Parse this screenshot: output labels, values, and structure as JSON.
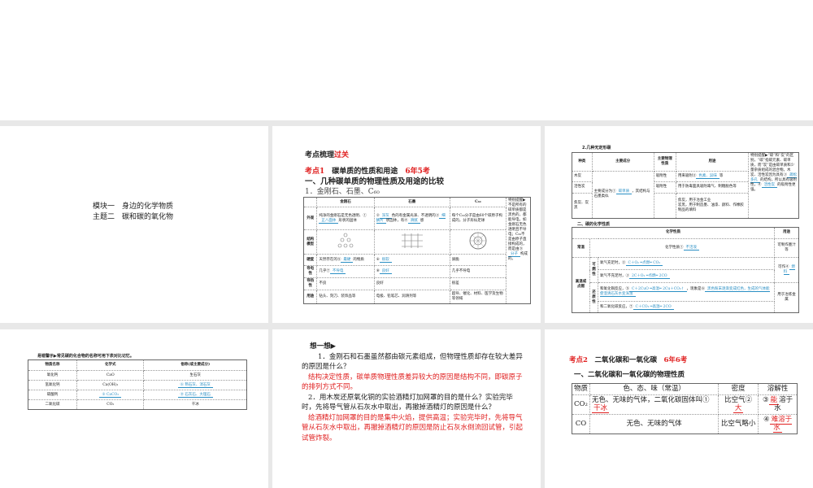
{
  "slide1": {
    "line1": "模块一　身边的化学物质",
    "line2": "主题二　碳和碳的氧化物"
  },
  "slide2": {
    "heading_a": "考点梳理",
    "heading_b": "过关",
    "kd": "考点1",
    "kd_title": "碳单质的性质和用途",
    "kd_freq": "6年5考",
    "sec": "一、几种碳单质的物理性质及用途的比较",
    "sub": "1．金刚石、石墨、C₆₀",
    "headers": [
      "",
      "金刚石",
      "石墨",
      "C₆₀"
    ],
    "rows": [
      {
        "h": "外观",
        "c1": "纯净的金刚石是无色透明、①",
        "a1": "正八面体",
        "c1b": "形状的固体",
        "c2": "②",
        "a2": "深灰",
        "c2b": "色的有金属光泽、不透明的③",
        "a2b": "细鳞片",
        "c2c": "状固体，有④",
        "a2c": "滑腻",
        "c2d": "感",
        "c3": "每个C₆₀分子是由60个碳原子构成的，分子形似足球"
      },
      {
        "h": "结构模型"
      },
      {
        "h": "硬度",
        "c1": "天然存在的⑤",
        "a1": "最硬",
        "c1b": "的物质",
        "c2": "⑥",
        "a2": "很软",
        "c3": "质脆"
      },
      {
        "h": "导电性",
        "c1": "几乎⑦",
        "a1": "不导电",
        "c2": "⑧",
        "a2": "良好",
        "c3": "几乎不导电"
      },
      {
        "h": "导热性",
        "c1": "不良",
        "c2": "良好",
        "c3": "很差"
      },
      {
        "h": "用途",
        "c1": "钻头、刻刀、装饰品等",
        "c2": "电极、铅笔芯、润滑剂等",
        "c3": "超导、催化、材料、医学及生物等领域"
      }
    ],
    "tip": "特别提醒▶不是所有的碳单质都是黑色的，都能导电，如金刚石无色透明且不导电；C₆₀不是由原子直接构成的，而是由⑨",
    "tip_ans": "分子",
    "tip_end": "构成的。"
  },
  "slide3": {
    "t1": "2.几种无定形碳",
    "h1": [
      "种类",
      "主要成分",
      "主要物理性质",
      "用途"
    ],
    "r_mutan": "木炭",
    "r_huoxing": "活性炭",
    "r_jiao": "焦炭、炭黑",
    "comp": "主要成分为①",
    "comp_ans": "碳单质",
    "comp_b": "，其结构与石墨类似",
    "xifu": "吸附性",
    "use1": "用来吸附②",
    "use1_ans": "色素、异味",
    "use1_b": "等",
    "use2": "用于防毒面具吸附毒气、制糖脱色等",
    "use3a": "焦炭，用于冶金工业",
    "use3b": "炭黑，用于制造墨、油漆、颜料、作橡胶制品的填料",
    "tip": "特别提醒▶“碳”和“炭”的区别，“碳”指碳元素、碳单质，而“炭”是由碳单质和少量杂质组成的混合物。木炭、活性炭因为具有③",
    "tip_ans": "疏松多孔",
    "tip_b": "的结构，所以具有吸附性，④",
    "tip_ans2": "活性炭",
    "tip_c": "的吸附性更强。",
    "t2": "二、碳的化学性质",
    "h2": [
      "化学性质",
      "用途"
    ],
    "changwen": "常温",
    "cw_prop": "化学性质①",
    "cw_ans": "不活泼",
    "cw_use": "可制作墨汁等",
    "gaowen": "高温或点燃",
    "kerx": "可燃性",
    "o2_full": "氧气充足时，②",
    "o2_full_ans": "C＋O₂ ═点燃═ CO₂",
    "o2_less": "氧气不充足时，③",
    "o2_less_ans": "2C＋O₂ ═点燃═ 2CO",
    "fuel": "可作④",
    "fuel_ans": "燃料",
    "huanyuan": "还原性",
    "cuo": "和氧化铜反应，⑤",
    "cuo_ans": "C＋2CuO ═高温═ 2Cu＋CO₂↑",
    "cuo_b": "，现象是⑥",
    "cuo_ans2": "黑色粉末逐渐变成红色，生成的气体能使澄清石灰水变浑浊",
    "co2": "和二氧化碳反应，⑦",
    "co2_ans": "C＋CO₂ ═高温═ 2CO",
    "metal": "用于冶炼金属"
  },
  "slide4": {
    "title": "易错警示▶常见碳的化合物的名称可用下表对比记忆。",
    "headers": [
      "物质名称",
      "化学式",
      "俗称(或主要成分)"
    ],
    "rows": [
      [
        "氧化钙",
        "CaO",
        "生石灰"
      ],
      [
        "氢氧化钙",
        "Ca(OH)₂",
        "⑥ 熟石灰、消石灰"
      ],
      [
        "碳酸钙",
        "⑤ CaCO₃",
        "⑧ 石灰石、大理石"
      ],
      [
        "二氧化碳",
        "CO₂",
        "干冰"
      ]
    ]
  },
  "slide5": {
    "title": "想一想▶",
    "q1": "1．金刚石和石墨虽然都由碳元素组成，但物理性质却存在较大差异的原因是什么？",
    "a1": "结构决定性质，碳单质物理性质差异较大的原因是结构不同，即碳原子的排列方式不同。",
    "q2": "2．用木炭还原氧化铜的实验酒精灯加网罩的目的是什么？实验完毕时，先将导气管从石灰水中取出，再撤掉酒精灯的原因是什么？",
    "a2": "给酒精灯加网罩的目的是集中火焰，提供高温；实验完毕时，先将导气管从石灰水中取出，再撤掉酒精灯的原因是防止石灰水倒流回试管，引起试管炸裂。"
  },
  "slide6": {
    "kd": "考点2",
    "title": "二氧化碳和一氧化碳",
    "freq": "6年6考",
    "sec": "一、二氧化碳和一氧化碳的物理性质",
    "headers": [
      "物质",
      "色、态、味（常温）",
      "密度",
      "溶解性"
    ],
    "co2": "CO₂",
    "co2_color": "无色、无味的气体，二氧化碳固体叫①",
    "co2_color_ans": "干冰",
    "co2_den": "比空气②",
    "co2_den_ans": "大",
    "co2_sol": "③",
    "co2_sol_ans": "能",
    "co2_sol_b": "溶于水",
    "co": "CO",
    "co_color": "无色、无味的气体",
    "co_den": "比空气略小",
    "co_sol": "④",
    "co_sol_ans": "难溶于水"
  }
}
